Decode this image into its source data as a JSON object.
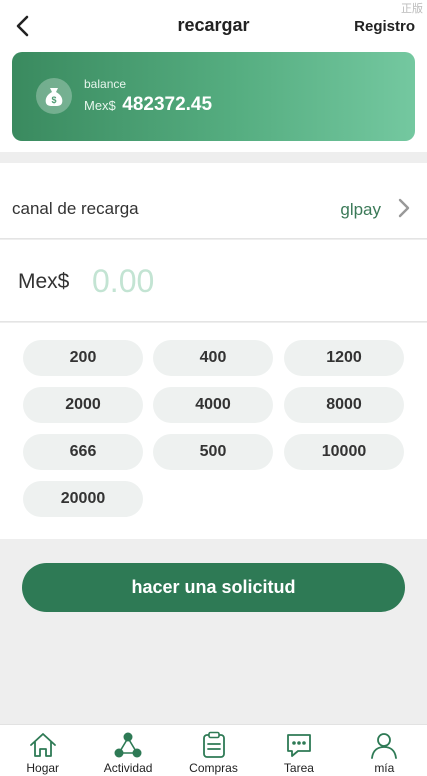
{
  "header": {
    "title": "recargar",
    "right_link": "Registro"
  },
  "balance": {
    "label": "balance",
    "currency": "Mex$",
    "amount": "482372.45"
  },
  "channel": {
    "label": "canal de recarga",
    "value": "glpay"
  },
  "amount": {
    "currency": "Mex$",
    "placeholder": "0.00"
  },
  "quick_amounts": [
    "200",
    "400",
    "1200",
    "2000",
    "4000",
    "8000",
    "666",
    "500",
    "10000",
    "20000"
  ],
  "submit_label": "hacer una solicitud",
  "tabs": [
    {
      "label": "Hogar",
      "icon": "home-icon"
    },
    {
      "label": "Actividad",
      "icon": "activity-icon"
    },
    {
      "label": "Compras",
      "icon": "clipboard-icon"
    },
    {
      "label": "Tarea",
      "icon": "chat-icon"
    },
    {
      "label": "mía",
      "icon": "user-icon"
    }
  ],
  "corner_mark": "正版",
  "colors": {
    "primary": "#2e7a55",
    "accent_text": "#3b7a58",
    "placeholder": "#c3e4d3",
    "chip_bg": "#eef1f0"
  }
}
